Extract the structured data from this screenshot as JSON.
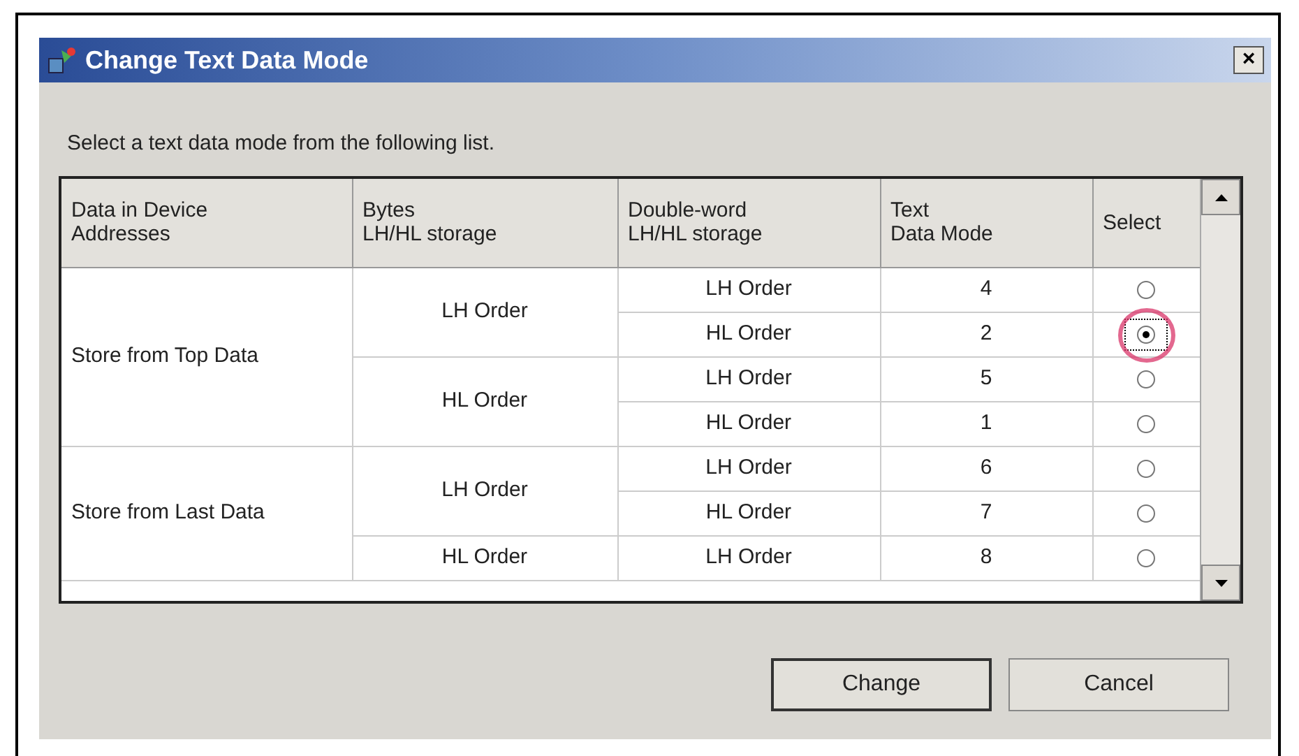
{
  "window": {
    "title": "Change Text Data Mode",
    "close": "×"
  },
  "instruction": "Select a text data mode from the following list.",
  "table": {
    "columns": [
      [
        "Data in Device",
        "Addresses"
      ],
      [
        "Bytes",
        "LH/HL storage"
      ],
      [
        "Double-word",
        "LH/HL storage"
      ],
      [
        "Text",
        "Data Mode"
      ],
      [
        "Select"
      ]
    ],
    "groups": [
      {
        "label": "Store from Top Data",
        "bytes": [
          {
            "label": "LH Order",
            "rows": [
              {
                "dword": "LH Order",
                "mode": "4",
                "selected": false
              },
              {
                "dword": "HL Order",
                "mode": "2",
                "selected": true
              }
            ]
          },
          {
            "label": "HL Order",
            "rows": [
              {
                "dword": "LH Order",
                "mode": "5",
                "selected": false
              },
              {
                "dword": "HL Order",
                "mode": "1",
                "selected": false
              }
            ]
          }
        ]
      },
      {
        "label": "Store from Last Data",
        "bytes": [
          {
            "label": "LH Order",
            "rows": [
              {
                "dword": "LH Order",
                "mode": "6",
                "selected": false
              },
              {
                "dword": "HL Order",
                "mode": "7",
                "selected": false
              }
            ]
          },
          {
            "label": "HL Order",
            "rows": [
              {
                "dword": "LH Order",
                "mode": "8",
                "selected": false
              }
            ]
          }
        ]
      }
    ]
  },
  "buttons": [
    "Change",
    "Cancel"
  ]
}
